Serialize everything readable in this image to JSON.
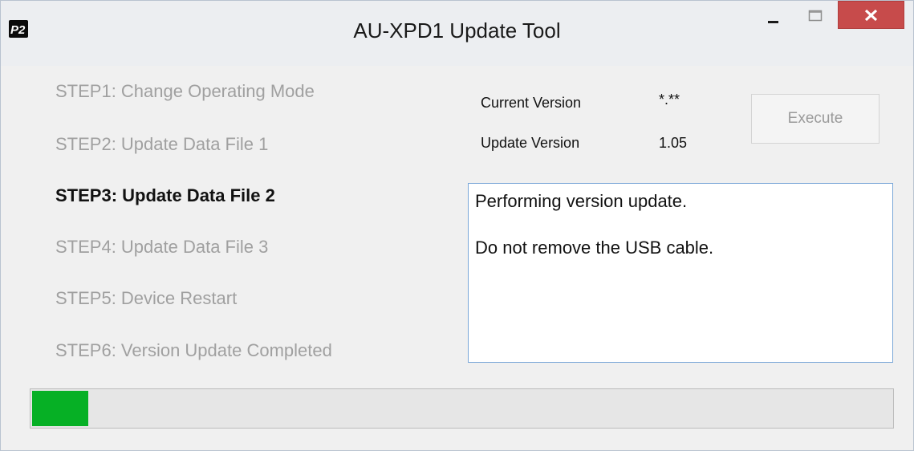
{
  "window": {
    "title": "AU-XPD1 Update Tool",
    "icon": "p2-app-icon",
    "close_color": "#c74b4b"
  },
  "steps": [
    {
      "label": "STEP1: Change Operating Mode",
      "state": "inactive"
    },
    {
      "label": "STEP2: Update Data File 1",
      "state": "inactive"
    },
    {
      "label": "STEP3: Update Data File 2",
      "state": "active"
    },
    {
      "label": "STEP4: Update Data File 3",
      "state": "inactive"
    },
    {
      "label": "STEP5: Device Restart",
      "state": "inactive"
    },
    {
      "label": "STEP6: Version Update Completed",
      "state": "inactive"
    }
  ],
  "versions": {
    "current_label": "Current Version",
    "current_value": "*.**",
    "update_label": "Update Version",
    "update_value": "1.05"
  },
  "execute_button": {
    "label": "Execute",
    "enabled": false
  },
  "message": {
    "line1": "Performing version update.",
    "line2": "Do not remove the USB cable."
  },
  "progress": {
    "fraction": 0.065,
    "color": "#06b025"
  }
}
